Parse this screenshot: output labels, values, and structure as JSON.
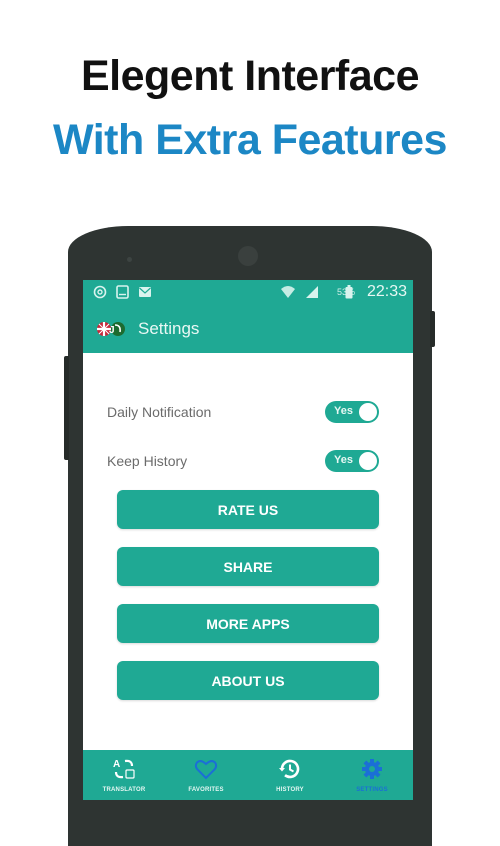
{
  "promo": {
    "line1": "Elegent Interface",
    "line2": "With Extra Features"
  },
  "colors": {
    "accent": "#1fa994",
    "headline_blue": "#1c87c5",
    "active_nav": "#1b6fd6",
    "phone_body": "#2e3432"
  },
  "status_bar": {
    "left_icons": [
      "sync-icon",
      "tablet-icon",
      "mail-icon"
    ],
    "right_icons": [
      "wifi-icon",
      "signal-icon",
      "battery-icon"
    ],
    "battery_percent": "53%",
    "time": "22:33"
  },
  "toolbar": {
    "logo": "app-logo-flags-icon",
    "title": "Settings"
  },
  "settings": [
    {
      "label": "Daily Notification",
      "toggle_text": "Yes",
      "enabled": true
    },
    {
      "label": "Keep History",
      "toggle_text": "Yes",
      "enabled": true
    }
  ],
  "actions": [
    {
      "label": "RATE US"
    },
    {
      "label": "SHARE"
    },
    {
      "label": "MORE APPS"
    },
    {
      "label": "ABOUT US"
    }
  ],
  "bottom_nav": [
    {
      "label": "TRANSLATOR",
      "icon": "translate-icon",
      "active": false
    },
    {
      "label": "FAVORITES",
      "icon": "heart-icon",
      "active": false
    },
    {
      "label": "HISTORY",
      "icon": "history-icon",
      "active": false
    },
    {
      "label": "SETTINGS",
      "icon": "gear-icon",
      "active": true
    }
  ]
}
